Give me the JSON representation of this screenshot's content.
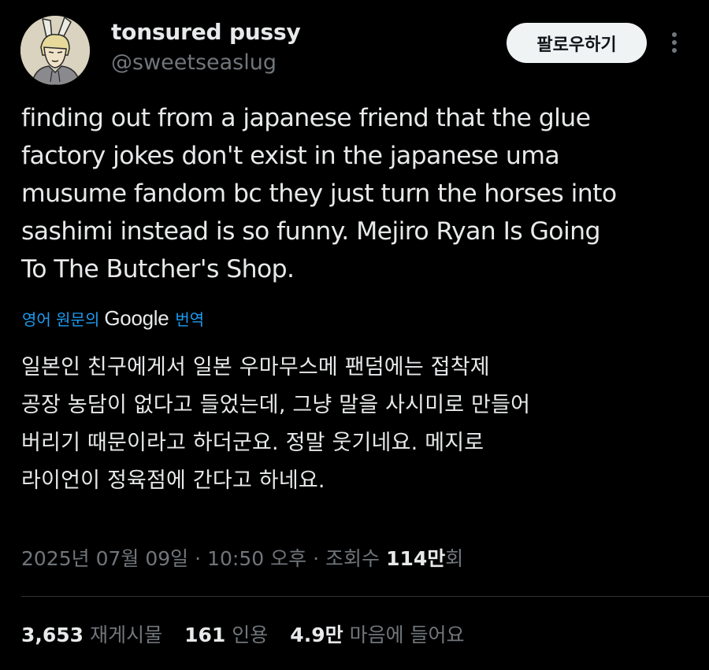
{
  "author": {
    "display_name": "tonsured pussy",
    "handle": "@sweetseaslug",
    "avatar_icon": "rabbit-ear-character-avatar"
  },
  "header": {
    "follow_label": "팔로우하기",
    "more_icon": "vertical-ellipsis-icon"
  },
  "tweet": {
    "lines": [
      "finding out from a japanese friend that the glue",
      "factory jokes don't exist in the japanese uma",
      "musume fandom bc they just turn the horses into",
      "sashimi instead is so funny. Mejiro Ryan Is Going",
      "To The Butcher's Shop."
    ]
  },
  "translation": {
    "prefix": "영어 원문의",
    "brand": "Google",
    "suffix": "번역",
    "lines": [
      "일본인 친구에게서 일본 우마무스메 팬덤에는 접착제",
      "공장 농담이 없다고 들었는데, 그냥 말을 사시미로 만들어",
      "버리기 때문이라고 하더군요. 정말 웃기네요. 메지로",
      "라이언이 정육점에 간다고 하네요."
    ]
  },
  "meta": {
    "date": "2025년 07월 09일",
    "time": "10:50 오후",
    "views_label": "조회수",
    "views_value": "114만",
    "views_unit": "회",
    "separator": "·"
  },
  "stats": {
    "reposts_value": "3,653",
    "reposts_label": "재게시물",
    "quotes_value": "161",
    "quotes_label": "인용",
    "likes_value": "4.9만",
    "likes_label": "마음에 들어요"
  },
  "colors": {
    "background": "#000000",
    "text": "#e7e9ea",
    "secondary": "#71767b",
    "link": "#1d9bf0",
    "button_bg": "#eff3f4"
  }
}
